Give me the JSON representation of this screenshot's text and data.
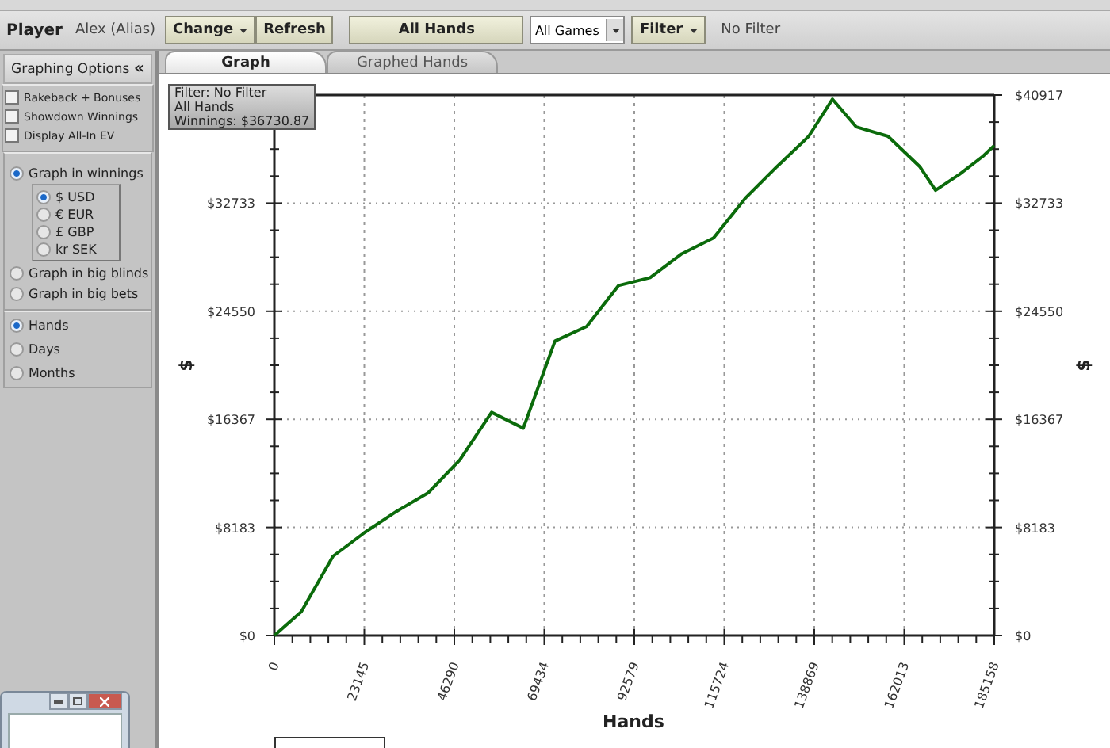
{
  "toolbar": {
    "player_label": "Player",
    "player_name": "Alex (Alias)",
    "buttons": [
      {
        "label": "Change",
        "kind": "dropdown"
      },
      {
        "label": "Refresh",
        "kind": "plain"
      },
      {
        "label": "All Hands",
        "kind": "wide"
      }
    ],
    "games_select": {
      "value": "All Games"
    },
    "filter_button": {
      "label": "Filter",
      "kind": "dropdown"
    },
    "filter_status": "No Filter"
  },
  "sidebar": {
    "title": "Graphing Options",
    "collapse": "«",
    "checkboxes": [
      {
        "label": "Rakeback + Bonuses",
        "checked": false
      },
      {
        "label": "Showdown Winnings",
        "checked": false
      },
      {
        "label": "Display All-In EV",
        "checked": false
      }
    ],
    "graph_modes": [
      {
        "label": "Graph in winnings",
        "selected": true,
        "options": [
          {
            "label": "$ USD",
            "selected": true
          },
          {
            "label": "€ EUR",
            "selected": false
          },
          {
            "label": "£ GBP",
            "selected": false
          },
          {
            "label": "kr SEK",
            "selected": false
          }
        ]
      },
      {
        "label": "Graph in big blinds",
        "selected": false
      },
      {
        "label": "Graph in big bets",
        "selected": false
      }
    ],
    "time_units": [
      {
        "label": "Hands",
        "selected": true
      },
      {
        "label": "Days",
        "selected": false
      },
      {
        "label": "Months",
        "selected": false
      }
    ]
  },
  "tabs": [
    {
      "label": "Graph",
      "selected": true
    },
    {
      "label": "Graphed Hands",
      "selected": false
    }
  ],
  "info_box": {
    "lines": [
      "Filter: No Filter",
      "All Hands",
      "Winnings: $36730.87"
    ]
  },
  "chart": {
    "chart_data": {
      "type": "line",
      "xlabel": "Hands",
      "ylabel": "$",
      "x": [
        0,
        6933,
        15089,
        23245,
        31401,
        39557,
        47713,
        55869,
        64025,
        72181,
        80337,
        88493,
        96649,
        104805,
        112961,
        121117,
        129273,
        137429,
        143546,
        149664,
        157820,
        165976,
        170054,
        176171,
        182289,
        185158
      ],
      "grid": true,
      "series": [
        {
          "color": "#0b6b0b",
          "values": [
            0,
            1800,
            6000,
            7800,
            9400,
            10800,
            13300,
            16900,
            15700,
            22300,
            23400,
            26500,
            27100,
            28900,
            30100,
            33100,
            35500,
            37800,
            40600,
            38500,
            37800,
            35500,
            33700,
            34900,
            36300,
            37100
          ]
        }
      ],
      "xlim": [
        0,
        185158
      ],
      "ylim": [
        0,
        40917
      ],
      "xticks": [
        0,
        23145,
        46290,
        69434,
        92579,
        115724,
        138869,
        162013,
        185158
      ],
      "yticks": [
        {
          "value": 0,
          "label": "$0"
        },
        {
          "value": 8183,
          "label": "$8183"
        },
        {
          "value": 16367,
          "label": "$16367"
        },
        {
          "value": 24550,
          "label": "$24550"
        },
        {
          "value": 32733,
          "label": "$32733"
        },
        {
          "value": 40917,
          "label": "$40917"
        }
      ]
    }
  }
}
